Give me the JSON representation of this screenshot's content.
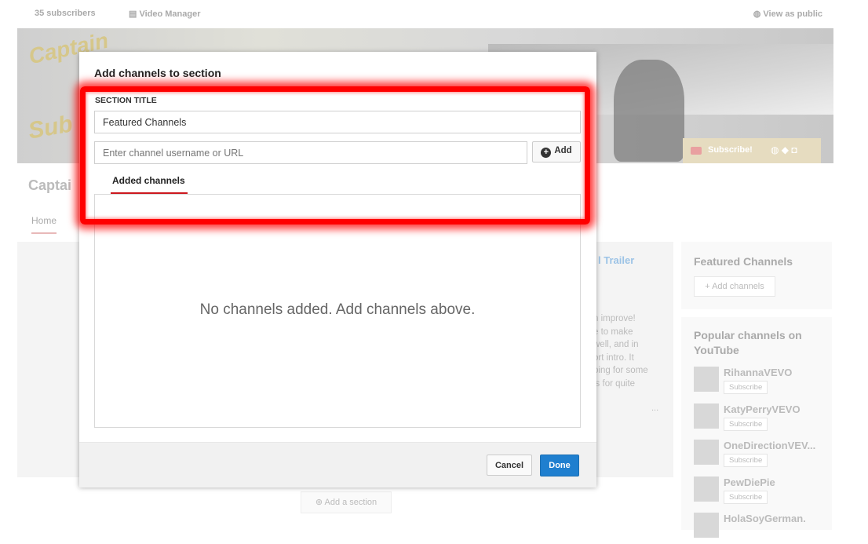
{
  "background": {
    "topbar": {
      "subscribers": "35 subscribers",
      "video_manager": "Video Manager",
      "view_as_public": "View as public"
    },
    "banner": {
      "logo_top": "Captain",
      "logo_bottom": "Sub",
      "subscribe_label": "Subscribe!"
    },
    "channel_name": "Captai",
    "nav_home": "Home",
    "trailer_link": "l Trailer",
    "trailer_text": "n improve!\ne to make\nwell, and in\nort intro. It\nping for some\nis for quite",
    "ellipsis": "...",
    "add_section": "Add a section",
    "featured": {
      "title": "Featured Channels",
      "add_button": "+ Add channels"
    },
    "popular": {
      "title": "Popular channels on YouTube",
      "channels": [
        {
          "name": "RihannaVEVO",
          "subscribe": "Subscribe"
        },
        {
          "name": "KatyPerryVEVO",
          "subscribe": "Subscribe"
        },
        {
          "name": "OneDirectionVEV...",
          "subscribe": "Subscribe"
        },
        {
          "name": "PewDiePie",
          "subscribe": "Subscribe"
        },
        {
          "name": "HolaSoyGerman.",
          "subscribe": ""
        }
      ]
    }
  },
  "modal": {
    "title": "Add channels to section",
    "section_title_label": "SECTION TITLE",
    "section_title_value": "Featured Channels",
    "channel_input_placeholder": "Enter channel username or URL",
    "add_label": "Add",
    "tab_label": "Added channels",
    "empty_message": "No channels added. Add channels above.",
    "cancel_label": "Cancel",
    "done_label": "Done"
  },
  "highlight_color": "#ff0000"
}
